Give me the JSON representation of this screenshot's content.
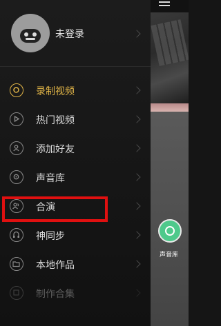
{
  "profile": {
    "username": "未登录"
  },
  "menu": {
    "items": [
      {
        "label": "录制视频",
        "icon": "record-icon"
      },
      {
        "label": "热门视频",
        "icon": "play-icon"
      },
      {
        "label": "添加好友",
        "icon": "add-friend-icon"
      },
      {
        "label": "声音库",
        "icon": "sound-library-icon"
      },
      {
        "label": "合演",
        "icon": "duet-icon"
      },
      {
        "label": "神同步",
        "icon": "sync-icon"
      },
      {
        "label": "本地作品",
        "icon": "folder-icon"
      },
      {
        "label": "制作合集",
        "icon": "collection-icon"
      }
    ]
  },
  "right_panel": {
    "voice_label": "声音库"
  },
  "colors": {
    "accent": "#e0b447",
    "highlight": "#e01010",
    "voice_button": "#4ec98b"
  }
}
